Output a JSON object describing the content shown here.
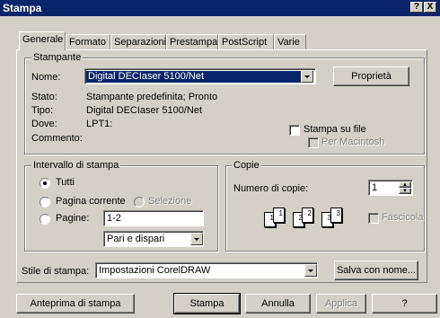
{
  "window": {
    "title": "Stampa"
  },
  "title_buttons": {
    "help": "?",
    "close": "X"
  },
  "tabs": [
    "Generale",
    "Formato",
    "Separazioni",
    "Prestampa",
    "PostScript",
    "Varie"
  ],
  "printer": {
    "legend": "Stampante",
    "name_label": "Nome:",
    "name_value": "Digital DECIaser 5100/Net",
    "properties_button": "Proprietà",
    "status_label": "Stato:",
    "status_value": "Stampante predefinita; Pronto",
    "type_label": "Tipo:",
    "type_value": "Digital DECIaser 5100/Net",
    "where_label": "Dove:",
    "where_value": "LPT1:",
    "comment_label": "Commento:",
    "print_to_file": "Stampa su file",
    "for_mac": "Per Macintosh"
  },
  "range": {
    "legend": "Intervallo di stampa",
    "all": "Tutti",
    "current_page": "Pagina corrente",
    "selection": "Selezione",
    "pages": "Pagine:",
    "pages_value": "1-2",
    "odd_even": "Pari e dispari"
  },
  "copies": {
    "legend": "Copie",
    "number_label": "Numero di copie:",
    "number_value": "1",
    "collate": "Fascicola",
    "page_numbers": [
      "1",
      "1",
      "2",
      "2",
      "3",
      "3"
    ]
  },
  "style": {
    "label": "Stile di stampa:",
    "value": "Impostazioni CorelDRAW",
    "save_as_button": "Salva con nome..."
  },
  "buttons": {
    "preview": "Anteprima di stampa",
    "print": "Stampa",
    "cancel": "Annulla",
    "apply": "Applica",
    "help": "?"
  }
}
